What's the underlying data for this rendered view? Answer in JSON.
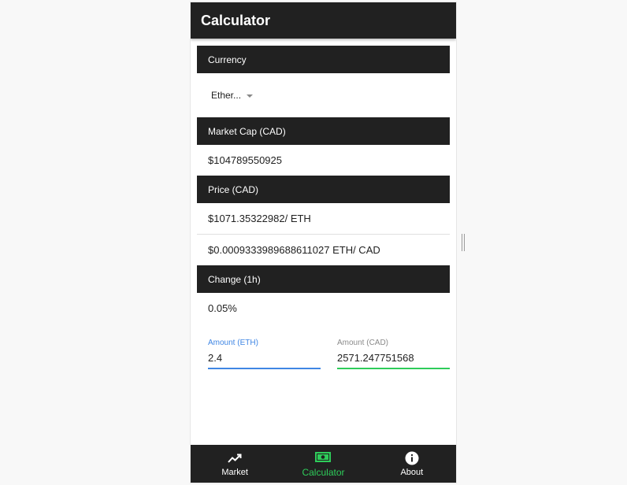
{
  "appbar": {
    "title": "Calculator"
  },
  "currency": {
    "header": "Currency",
    "selected": "Ether..."
  },
  "market_cap": {
    "header": "Market Cap (CAD)",
    "value": "$104789550925"
  },
  "price": {
    "header": "Price (CAD)",
    "per_coin": "$1071.35322982/ ETH",
    "per_fiat": "$0.0009333989688611027 ETH/ CAD"
  },
  "change": {
    "header": "Change (1h)",
    "value": "0.05%"
  },
  "amounts": {
    "eth_label": "Amount (ETH)",
    "eth_value": "2.4",
    "cad_label": "Amount (CAD)",
    "cad_value": "2571.247751568"
  },
  "nav": {
    "market": "Market",
    "calculator": "Calculator",
    "about": "About"
  },
  "colors": {
    "bar": "#212121",
    "accent_green": "#2ecc5a",
    "accent_blue": "#3f86e4"
  },
  "icons": {
    "market": "trending-up-icon",
    "calculator": "cash-icon",
    "about": "info-icon"
  }
}
